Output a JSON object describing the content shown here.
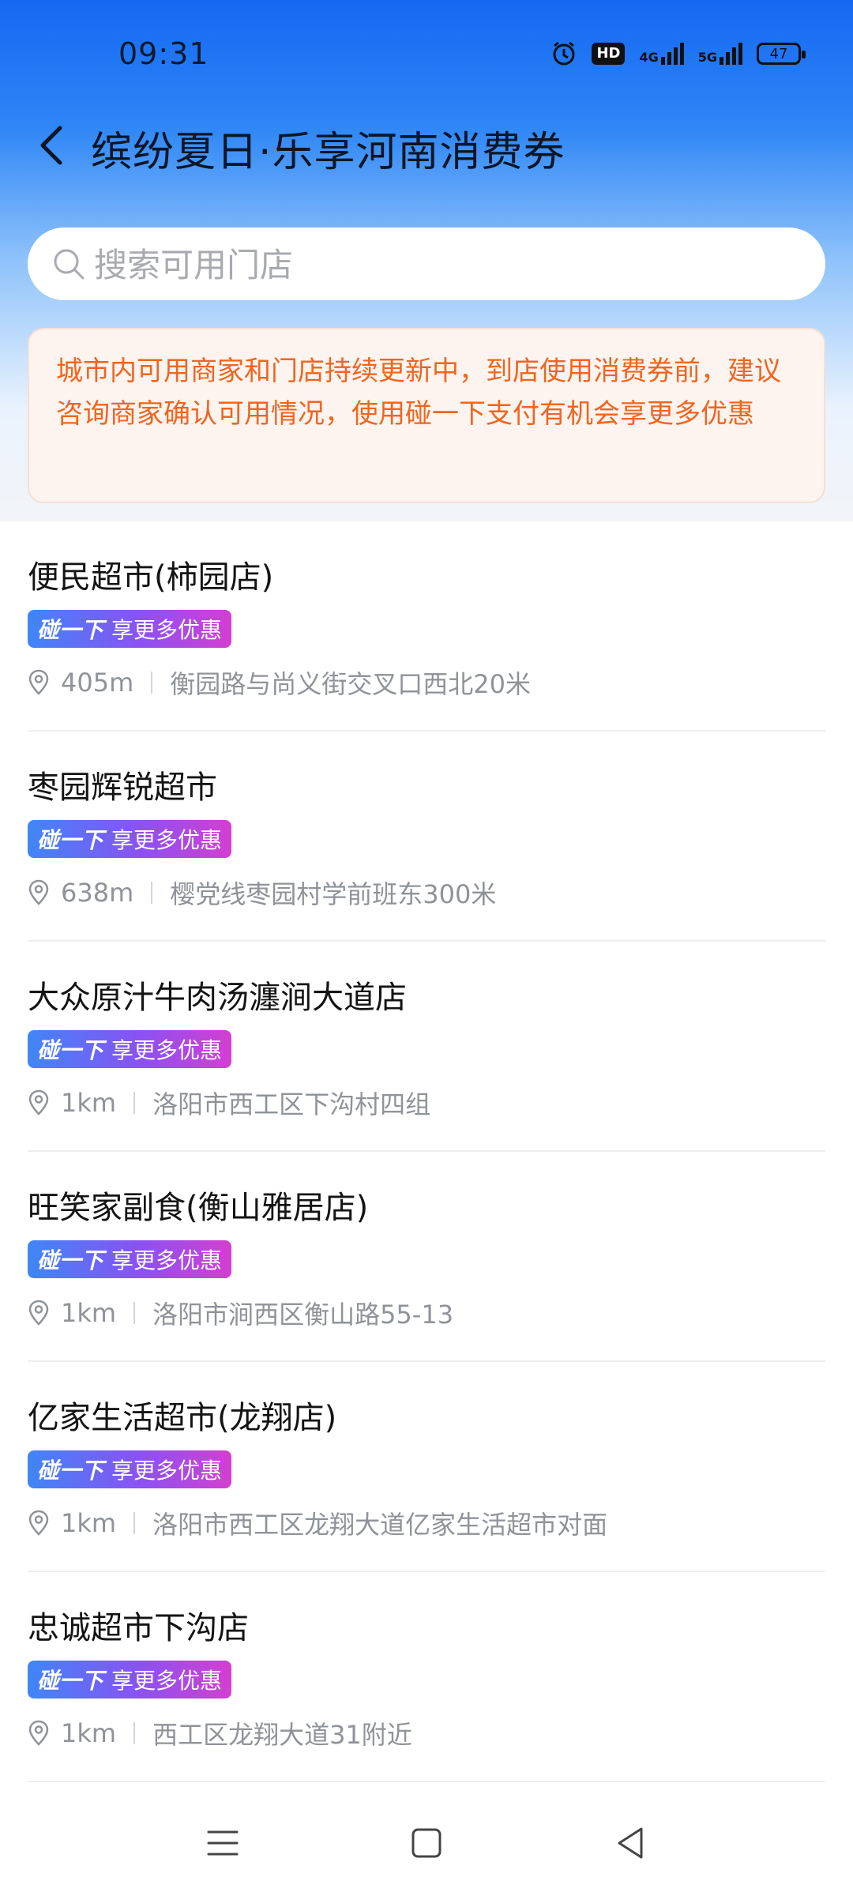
{
  "status_bar": {
    "time": "09:31",
    "hd_label": "HD",
    "signal1_label": "4G",
    "signal2_label": "5G",
    "battery": "47"
  },
  "header": {
    "title": "缤纷夏日·乐享河南消费券"
  },
  "search": {
    "placeholder": "搜索可用门店"
  },
  "notice": {
    "text": "城市内可用商家和门店持续更新中，到店使用消费券前，建议咨询商家确认可用情况，使用碰一下支付有机会享更多优惠"
  },
  "stores": [
    {
      "name": "便民超市(柿园店)",
      "tag_tap": "碰一下",
      "tag_text": "享更多优惠",
      "distance": "405m",
      "address": "衡园路与尚义街交叉口西北20米"
    },
    {
      "name": "枣园辉锐超市",
      "tag_tap": "碰一下",
      "tag_text": "享更多优惠",
      "distance": "638m",
      "address": "樱党线枣园村学前班东300米"
    },
    {
      "name": "大众原汁牛肉汤瀍涧大道店",
      "tag_tap": "碰一下",
      "tag_text": "享更多优惠",
      "distance": "1km",
      "address": "洛阳市西工区下沟村四组"
    },
    {
      "name": "旺笑家副食(衡山雅居店)",
      "tag_tap": "碰一下",
      "tag_text": "享更多优惠",
      "distance": "1km",
      "address": "洛阳市涧西区衡山路55-13"
    },
    {
      "name": "亿家生活超市(龙翔店)",
      "tag_tap": "碰一下",
      "tag_text": "享更多优惠",
      "distance": "1km",
      "address": "洛阳市西工区龙翔大道亿家生活超市对面"
    },
    {
      "name": "忠诚超市下沟店",
      "tag_tap": "碰一下",
      "tag_text": "享更多优惠",
      "distance": "1km",
      "address": "西工区龙翔大道31附近"
    }
  ],
  "icons": {
    "back": "back-arrow-icon",
    "search": "search-icon",
    "location": "location-pin-icon",
    "nav_menu": "menu-icon",
    "nav_home": "home-square-icon",
    "nav_back": "back-triangle-icon"
  },
  "colors": {
    "notice_text": "#f0651f",
    "tag_gradient_start": "#3f86f7",
    "tag_gradient_end": "#d43fd0",
    "header_blue": "#1568f2"
  }
}
